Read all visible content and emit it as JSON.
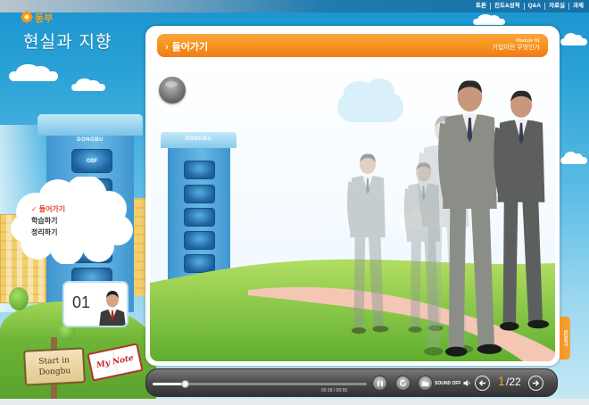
{
  "top_nav": {
    "links": [
      "토론",
      "진도&성적",
      "Q&A",
      "자료실",
      "과제"
    ]
  },
  "brand": {
    "name": "동부",
    "course_title": "현실과 지향"
  },
  "left_building": {
    "label": "DONGBU",
    "window_label": "OSF"
  },
  "menu": {
    "active_marker": "✓",
    "items": [
      {
        "label": "들어가기",
        "active": true
      },
      {
        "label": "학습하기",
        "active": false
      },
      {
        "label": "정리하기",
        "active": false
      }
    ]
  },
  "chapter": {
    "number": "01"
  },
  "sign": {
    "line1": "Start in",
    "line2": "Dongbu"
  },
  "note_book": {
    "label": "My Note"
  },
  "content": {
    "header_arrow": "›",
    "section_title": "들어가기",
    "module_label": "Module 01",
    "module_subtitle": "기업이란 무엇인가",
    "scene_building_label": "DONGBU",
    "script_tab": "SCRIPT"
  },
  "player": {
    "progress": 0.15,
    "time": "00:18 / 00:55",
    "sound_label": "SOUND OFF",
    "page_current": "1",
    "page_total": "/22",
    "controls": [
      "pause-icon",
      "replay-icon",
      "folder-icon",
      "speaker-icon",
      "prev-arrow-icon",
      "next-arrow-icon"
    ]
  },
  "colors": {
    "accent_orange": "#f7941d",
    "active_menu": "#e2462b",
    "page_current": "#f7a21b",
    "sky": "#2aa2d6",
    "grass": "#7cc242"
  }
}
